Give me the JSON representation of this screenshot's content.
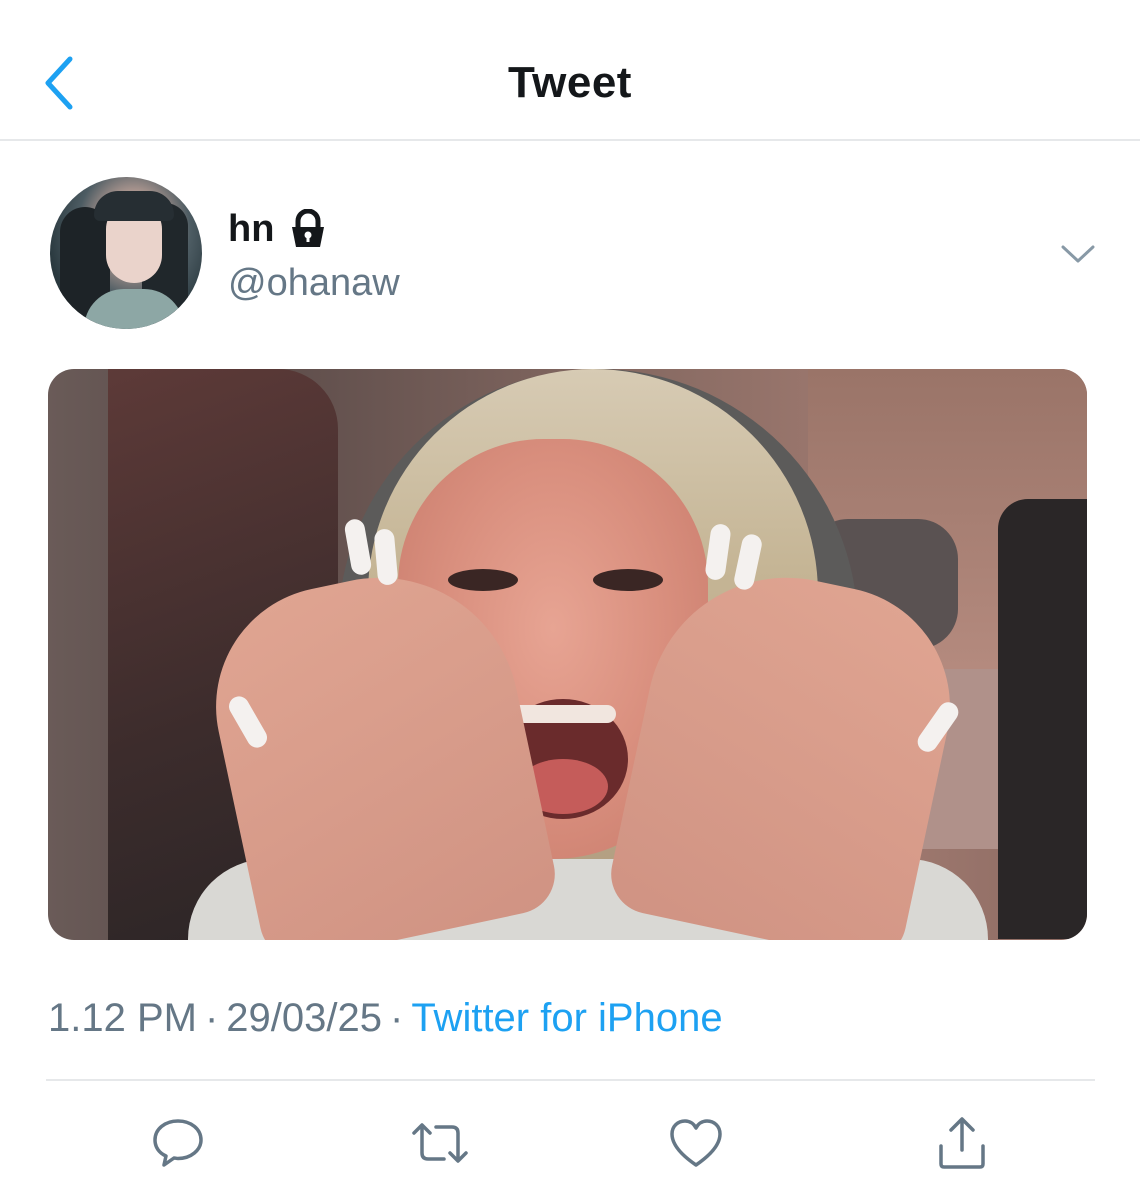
{
  "header": {
    "title": "Tweet",
    "back_icon": "chevron-left-icon"
  },
  "author": {
    "display_name": "hn",
    "handle": "@ohanaw",
    "protected_icon": "lock-icon",
    "more_icon": "chevron-down-icon"
  },
  "media": {
    "type": "photo"
  },
  "meta": {
    "time": "1.12 PM",
    "separator": "·",
    "date": "29/03/25",
    "source": "Twitter for iPhone"
  },
  "actions": {
    "reply_icon": "reply-icon",
    "retweet_icon": "retweet-icon",
    "like_icon": "heart-icon",
    "share_icon": "share-icon"
  },
  "colors": {
    "accent": "#1da1f2",
    "secondary_text": "#657786",
    "primary_text": "#14171a",
    "divider": "#e6e8ea"
  }
}
